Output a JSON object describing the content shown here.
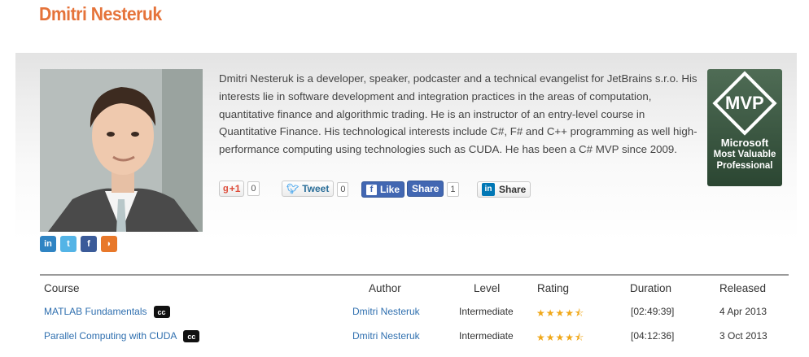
{
  "page": {
    "title": "Dmitri Nesteruk"
  },
  "profile": {
    "bio": "Dmitri Nesteruk is a developer, speaker, podcaster and a technical evangelist for JetBrains s.r.o. His interests lie in software development and integration practices in the areas of computation, quantitative finance and algorithmic trading. He is an instructor of an entry-level course in Quantitative Finance. His technological interests include C#, F# and C++ programming as well high-performance computing using technologies such as CUDA. He has been a C# MVP since 2009.",
    "social_icons": [
      "linkedin-icon",
      "twitter-icon",
      "facebook-icon",
      "rss-icon"
    ]
  },
  "share": {
    "gplus_label": "+1",
    "gplus_count": "0",
    "tweet_label": "Tweet",
    "tweet_count": "0",
    "fb_like_label": "Like",
    "fb_share_label": "Share",
    "fb_count": "1",
    "linkedin_label": "Share"
  },
  "mvp": {
    "badge_text": "MVP",
    "line1": "Microsoft",
    "line2": "Most Valuable",
    "line3": "Professional"
  },
  "courses": {
    "headers": {
      "course": "Course",
      "author": "Author",
      "level": "Level",
      "rating": "Rating",
      "duration": "Duration",
      "released": "Released"
    },
    "rows": [
      {
        "course": "MATLAB Fundamentals",
        "author": "Dmitri Nesteruk",
        "level": "Intermediate",
        "rating": 4.5,
        "rating_stars": "★★★★⯪",
        "duration": "[02:49:39]",
        "released": "4 Apr 2013"
      },
      {
        "course": "Parallel Computing with CUDA",
        "author": "Dmitri Nesteruk",
        "level": "Intermediate",
        "rating": 4.5,
        "rating_stars": "★★★★⯪",
        "duration": "[04:12:36]",
        "released": "3 Oct 2013"
      }
    ],
    "cc_label": "cc"
  },
  "colors": {
    "title": "#e5733a",
    "link": "#2f6faf",
    "star": "#f0a81a",
    "mvp_green": "#3b5a42"
  }
}
